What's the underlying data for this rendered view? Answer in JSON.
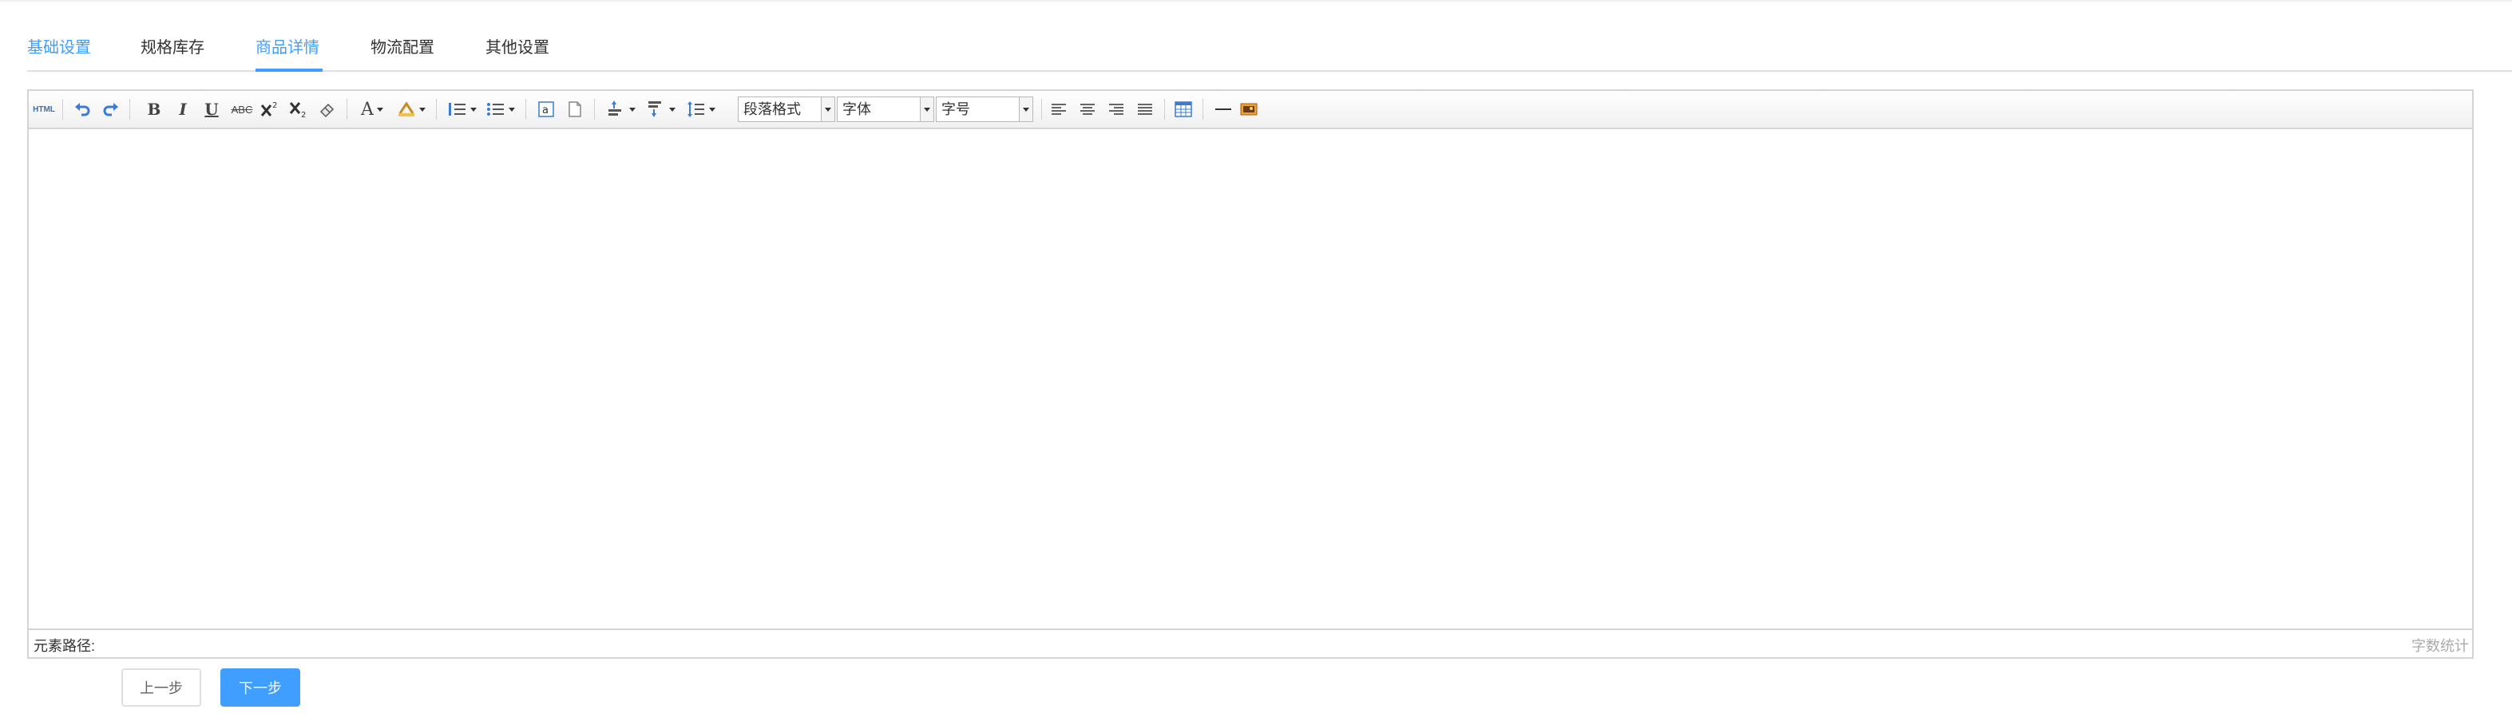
{
  "tabs": [
    {
      "label": "基础设置",
      "color": "#409eff"
    },
    {
      "label": "规格库存"
    },
    {
      "label": "商品详情",
      "active": true,
      "color": "#409eff"
    },
    {
      "label": "物流配置"
    },
    {
      "label": "其他设置"
    }
  ],
  "toolbar": {
    "html_label": "HTML",
    "bold_label": "B",
    "italic_label": "I",
    "underline_label": "U",
    "strike_label": "ABC",
    "fontcolor_label": "A",
    "paragraph_value": "段落格式",
    "fontfamily_value": "字体",
    "fontsize_value": "字号"
  },
  "editor": {
    "path_label": "元素路径:",
    "wordcount_label": "字数统计"
  },
  "buttons": {
    "prev_label": "上一步",
    "next_label": "下一步"
  },
  "colors": {
    "accent": "#409eff",
    "border": "#d4d4d4"
  },
  "icons": [
    "undo-icon",
    "redo-icon",
    "superscript-icon",
    "subscript-icon",
    "eraser-icon",
    "highlight-icon",
    "ordered-list-icon",
    "unordered-list-icon",
    "anchor-icon",
    "paste-plain-icon",
    "row-spacing-top-icon",
    "row-spacing-bottom-icon",
    "line-height-icon",
    "align-left-icon",
    "align-center-icon",
    "align-right-icon",
    "align-justify-icon",
    "table-icon",
    "horizontal-rule-icon",
    "image-icon"
  ]
}
